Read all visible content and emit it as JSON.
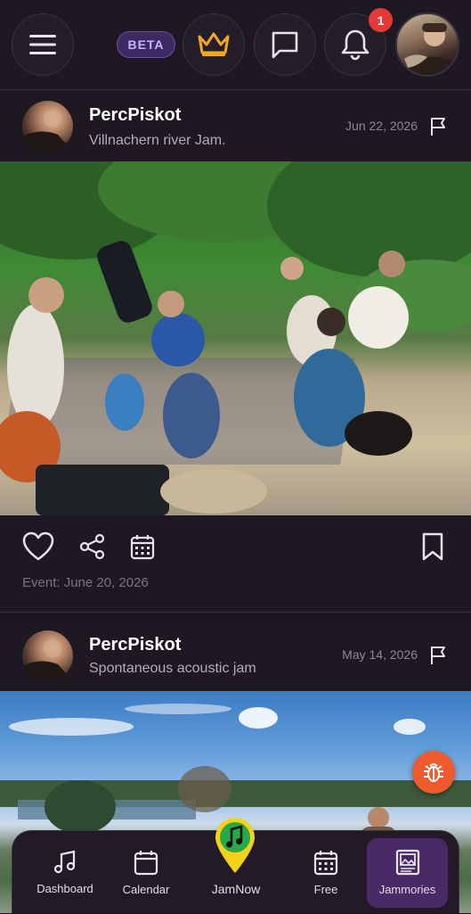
{
  "header": {
    "beta_label": "BETA",
    "notification_count": "1"
  },
  "posts": [
    {
      "username": "PercPiskot",
      "title": "Villnachern river Jam.",
      "date": "Jun 22, 2026",
      "event_text": "Event: June 20, 2026"
    },
    {
      "username": "PercPiskot",
      "title": "Spontaneous acoustic jam",
      "date": "May 14, 2026"
    }
  ],
  "nav": {
    "items": [
      {
        "label": "Dashboard",
        "icon": "music-note-icon"
      },
      {
        "label": "Calendar",
        "icon": "calendar-icon"
      },
      {
        "label": "JamNow",
        "icon": "map-pin-music-icon"
      },
      {
        "label": "Free",
        "icon": "calendar-grid-icon"
      },
      {
        "label": "Jammories",
        "icon": "photo-album-icon"
      }
    ],
    "active": "Jammories"
  },
  "colors": {
    "background": "#1b1520",
    "accent_gold": "#f2a81d",
    "badge_red": "#e53935",
    "active_purple": "#4a2a66",
    "bug_orange": "#ef5a2f"
  }
}
